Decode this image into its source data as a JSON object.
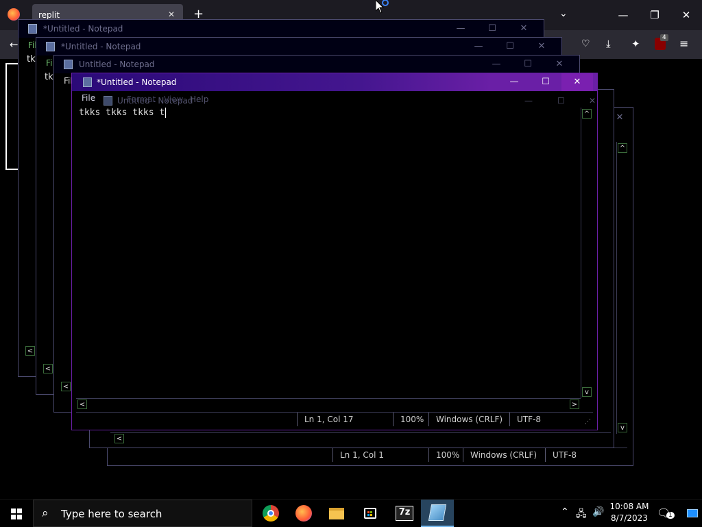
{
  "browser": {
    "tab_title": "replit",
    "tab_close": "✕",
    "new_tab": "+",
    "ext_badge": "4",
    "window": {
      "minimize": "—",
      "restore": "❐",
      "close": "✕"
    }
  },
  "notepad": {
    "title_dirty": "*Untitled - Notepad",
    "title_clean": "Untitled - Notepad",
    "menu": [
      "File",
      "Edit",
      "Format",
      "View",
      "Help"
    ],
    "content": "tkks tkks tkks t",
    "bg_left_labels": [
      "Fil",
      "tk",
      "Fi",
      "tk",
      "Fil"
    ],
    "status_front": {
      "pos": "Ln 1, Col 17",
      "zoom": "100%",
      "eol": "Windows (CRLF)",
      "enc": "UTF-8"
    },
    "status_back": {
      "pos": "Ln 1, Col 1",
      "zoom": "100%",
      "eol": "Windows (CRLF)",
      "enc": "UTF-8"
    },
    "controls": {
      "minimize": "—",
      "maximize": "☐",
      "close": "✕"
    }
  },
  "taskbar": {
    "search_placeholder": "Type here to search",
    "time": "10:08 AM",
    "date": "8/7/2023",
    "notif_count": "1",
    "apps": [
      "chrome",
      "firefox",
      "file-explorer",
      "microsoft-store",
      "7zip",
      "notepad"
    ]
  },
  "colors": {
    "active_title_start": "#2b0a78",
    "active_title_end": "#6a1fa6",
    "taskbar": "#000000",
    "browser_toolbar": "#2b2a33"
  }
}
